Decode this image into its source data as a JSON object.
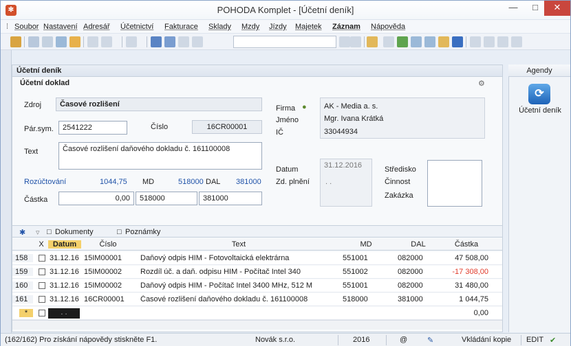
{
  "window": {
    "title": "POHODA Komplet - [Účetní deník]"
  },
  "menu": [
    "Soubor",
    "Nastavení",
    "Adresář",
    "Účetnictví",
    "Fakturace",
    "Sklady",
    "Mzdy",
    "Jízdy",
    "Majetek",
    "Záznam",
    "Nápověda"
  ],
  "panel": {
    "title": "Účetní deník",
    "section": "Účetní doklad"
  },
  "form": {
    "zdroj_label": "Zdroj",
    "zdroj_value": "Časové rozlišení",
    "parsym_label": "Pár.sym.",
    "parsym_value": "2541222",
    "cislo_label": "Číslo",
    "cislo_value": "16CR00001",
    "text_label": "Text",
    "text_value": "Časové rozlišení daňového dokladu č. 161100008",
    "rozuct_label": "Rozúčtování",
    "rozuct_value": "1044,75",
    "md_label": "MD",
    "md_value": "518000",
    "dal_label": "DAL",
    "dal_value": "381000",
    "castka_label": "Částka",
    "castka_value": "0,00",
    "castka_md": "518000",
    "castka_dal": "381000",
    "firma_label": "Firma",
    "firma_value": "AK - Media a. s.",
    "jmeno_label": "Jméno",
    "jmeno_value": "Mgr. Ivana Krátká",
    "ic_label": "IČ",
    "ic_value": "33044934",
    "datum_label": "Datum",
    "datum_value": "31.12.2016",
    "zdplneni_label": "Zd. plnění",
    "zdplneni_value": ". .",
    "stredisko_label": "Středisko",
    "cinnost_label": "Činnost",
    "zakazka_label": "Zakázka"
  },
  "agenda": {
    "title": "Agendy",
    "item": "Účetní deník"
  },
  "tabs": {
    "dokumenty": "Dokumenty",
    "poznamky": "Poznámky"
  },
  "grid": {
    "headers": {
      "x": "X",
      "datum": "Datum",
      "cislo": "Číslo",
      "text": "Text",
      "md": "MD",
      "dal": "DAL",
      "castka": "Částka"
    },
    "rows": [
      {
        "num": "158",
        "datum": "31.12.16",
        "cislo": "15IM00001",
        "text": "Daňový odpis HIM - Fotovoltaická elektrárna",
        "md": "551001",
        "dal": "082000",
        "castka": "47 508,00",
        "neg": false
      },
      {
        "num": "159",
        "datum": "31.12.16",
        "cislo": "15IM00002",
        "text": "Rozdíl úč. a daň. odpisu HIM - Počítač Intel 340",
        "md": "551002",
        "dal": "082000",
        "castka": "-17 308,00",
        "neg": true
      },
      {
        "num": "160",
        "datum": "31.12.16",
        "cislo": "15IM00002",
        "text": "Daňový odpis HIM - Počítač Intel 3400 MHz, 512 M",
        "md": "551001",
        "dal": "082000",
        "castka": "31 480,00",
        "neg": false
      },
      {
        "num": "161",
        "datum": "31.12.16",
        "cislo": "16CR00001",
        "text": "Časové rozlišení daňového dokladu č. 161100008",
        "md": "518000",
        "dal": "381000",
        "castka": "1 044,75",
        "neg": false
      }
    ],
    "new_row": {
      "marker": "*",
      "datum": ". .",
      "castka": "0,00"
    }
  },
  "status": {
    "help": "(162/162) Pro získání nápovědy stiskněte F1.",
    "company": "Novák s.r.o.",
    "year": "2016",
    "mode": "Vkládání kopie",
    "edit": "EDIT"
  },
  "colors": {
    "negative": "#e03a2a",
    "link": "#1f52a8",
    "close": "#c9463d"
  }
}
